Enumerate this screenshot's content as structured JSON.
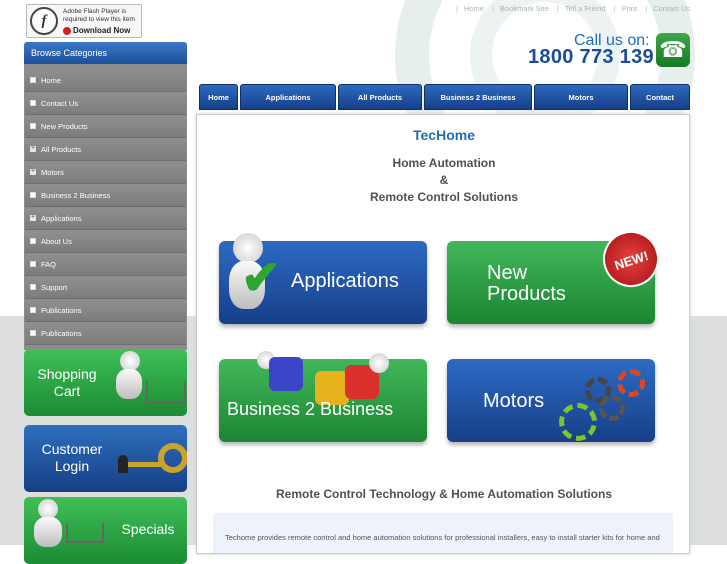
{
  "flash": {
    "line1": "Adobe Flash Player is required to view this item",
    "line2": "Download Now",
    "logo": "f"
  },
  "top_links": [
    "Home",
    "Bookmark Site",
    "Tell a Friend",
    "Print",
    "Contact Us"
  ],
  "call": {
    "label": "Call us on:",
    "number": "1800 773 139",
    "icon": "phone-icon"
  },
  "sidebar": {
    "title": "Browse Categories",
    "items": [
      {
        "label": "Home",
        "expandable": false
      },
      {
        "label": "Contact Us",
        "expandable": false
      },
      {
        "label": "New Products",
        "expandable": false
      },
      {
        "label": "All Products",
        "expandable": true
      },
      {
        "label": "Motors",
        "expandable": true
      },
      {
        "label": "Business 2 Business",
        "expandable": false
      },
      {
        "label": "Applications",
        "expandable": true
      },
      {
        "label": "About Us",
        "expandable": false
      },
      {
        "label": "FAQ",
        "expandable": false
      },
      {
        "label": "Support",
        "expandable": false
      },
      {
        "label": "Publications",
        "expandable": false
      },
      {
        "label": "Publications",
        "expandable": false
      }
    ]
  },
  "promos": {
    "cart": "Shopping Cart",
    "login": "Customer Login",
    "specials": "Specials"
  },
  "nav": [
    "Home",
    "Applications",
    "All Products",
    "Business 2 Business",
    "Motors",
    "Contact"
  ],
  "main": {
    "title": "TecHome",
    "sub1": "Home Automation",
    "sub2": "&",
    "sub3": "Remote Control Solutions",
    "tiles": {
      "applications": "Applications",
      "new_products_1": "New",
      "new_products_2": "Products",
      "new_badge": "NEW!",
      "b2b": "Business 2 Business",
      "motors": "Motors"
    },
    "bottom_heading": "Remote Control Technology & Home Automation Solutions",
    "description": "Techome provides remote control and home automation solutions for professional installers, easy to install starter kits for home and"
  },
  "colors": {
    "brand_blue": "#1b6fb7",
    "nav_blue": "#1d4f9a",
    "promo_green": "#2aa544",
    "sidebar_gray": "#8d8d8d"
  }
}
